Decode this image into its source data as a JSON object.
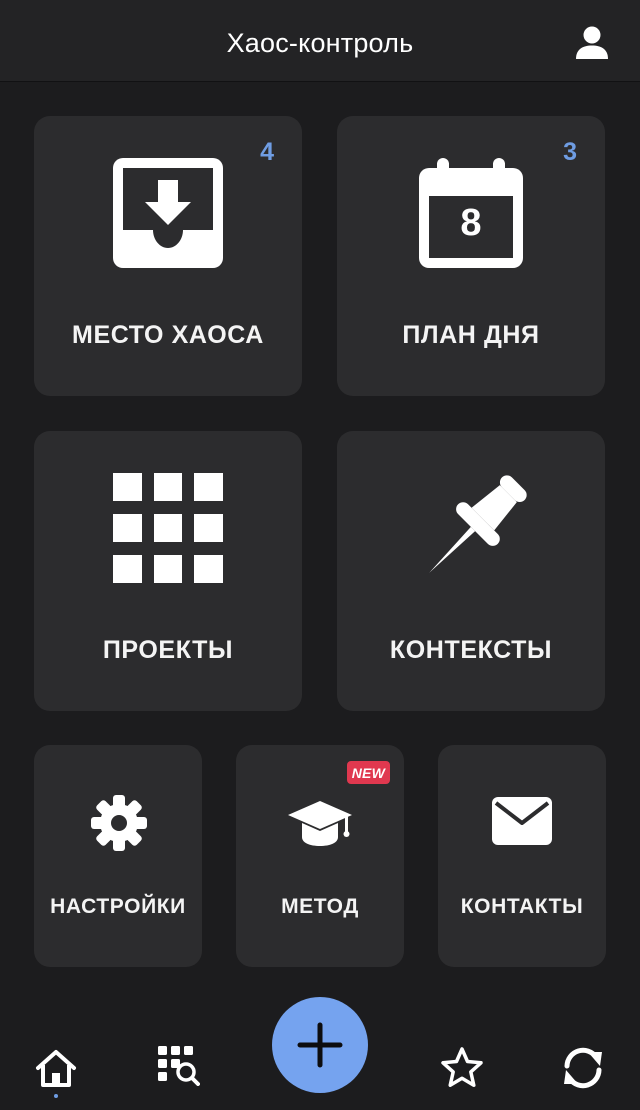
{
  "header": {
    "title": "Хаос-контроль",
    "profile_icon": "user-icon"
  },
  "tiles": {
    "inbox": {
      "label": "МЕСТО ХАОСА",
      "count": "4",
      "icon": "inbox-download-icon"
    },
    "day_plan": {
      "label": "ПЛАН ДНЯ",
      "count": "3",
      "icon": "calendar-icon",
      "calendar_day": "8"
    },
    "projects": {
      "label": "ПРОЕКТЫ",
      "icon": "grid-icon"
    },
    "contexts": {
      "label": "КОНТЕКСТЫ",
      "icon": "pushpin-icon"
    },
    "settings": {
      "label": "НАСТРОЙКИ",
      "icon": "gear-icon"
    },
    "method": {
      "label": "МЕТОД",
      "badge": "NEW",
      "icon": "graduation-cap-icon"
    },
    "contacts": {
      "label": "КОНТАКТЫ",
      "icon": "envelope-icon"
    }
  },
  "bottom_nav": {
    "items": [
      {
        "name": "home",
        "icon": "home-icon",
        "active": true
      },
      {
        "name": "search",
        "icon": "grid-search-icon",
        "active": false
      },
      {
        "name": "add",
        "icon": "plus-icon",
        "active": false
      },
      {
        "name": "favorites",
        "icon": "star-icon",
        "active": false
      },
      {
        "name": "sync",
        "icon": "sync-icon",
        "active": false
      }
    ]
  },
  "colors": {
    "background": "#1c1c1e",
    "tile": "#2c2c2e",
    "accent": "#6f9de3",
    "fab": "#75a3ef",
    "new_badge": "#e0384f"
  }
}
